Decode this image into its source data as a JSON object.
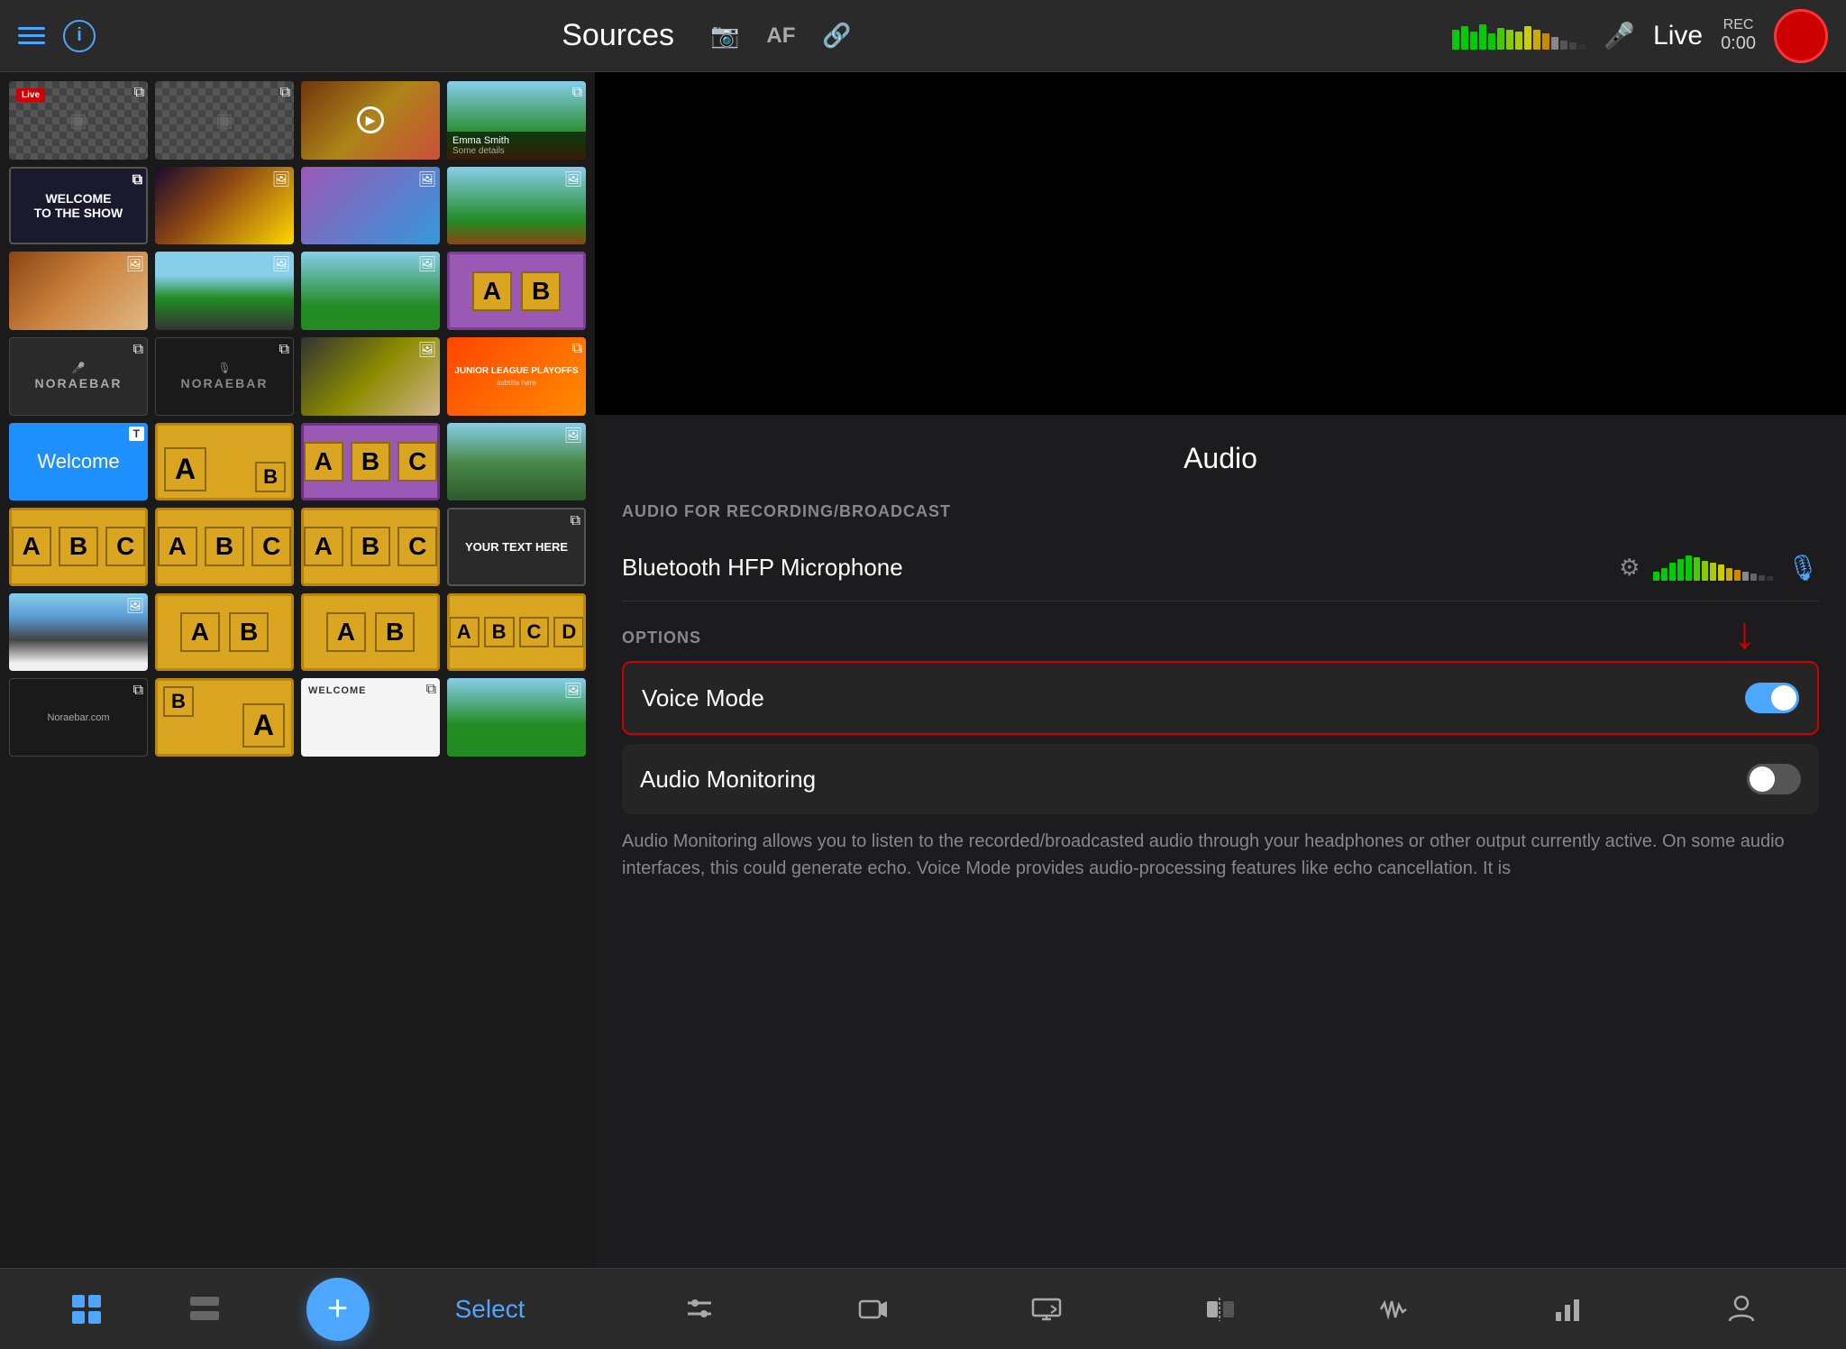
{
  "header": {
    "title": "Sources",
    "af_label": "AF",
    "live_label": "Live",
    "rec_label": "REC",
    "rec_time": "0:00"
  },
  "sources_grid": {
    "thumbnails": [
      {
        "id": 1,
        "type": "live_bar",
        "badge": "layers",
        "label": "Live"
      },
      {
        "id": 2,
        "type": "live_bar2",
        "badge": "layers",
        "label": ""
      },
      {
        "id": 3,
        "type": "crowd",
        "badge": "play",
        "label": ""
      },
      {
        "id": 4,
        "type": "person",
        "badge": "layers",
        "label": "Emma Smith"
      },
      {
        "id": 5,
        "type": "welcome",
        "badge": "layers",
        "text": "WELCOME TO THE SHOW",
        "label": ""
      },
      {
        "id": 6,
        "type": "concert",
        "badge": "image",
        "label": ""
      },
      {
        "id": 7,
        "type": "crowd2",
        "badge": "image",
        "label": ""
      },
      {
        "id": 8,
        "type": "city",
        "badge": "image",
        "label": ""
      },
      {
        "id": 9,
        "type": "building",
        "badge": "image",
        "label": ""
      },
      {
        "id": 10,
        "type": "city2",
        "badge": "image",
        "label": ""
      },
      {
        "id": 11,
        "type": "field",
        "badge": "image",
        "label": ""
      },
      {
        "id": 12,
        "type": "ab_purple",
        "badge": "",
        "label": "A B"
      },
      {
        "id": 13,
        "type": "norae",
        "badge": "layers",
        "label": "NORAEBAR"
      },
      {
        "id": 14,
        "type": "norae2",
        "badge": "layers",
        "label": "NORAEBAR"
      },
      {
        "id": 15,
        "type": "food",
        "badge": "image",
        "label": ""
      },
      {
        "id": 16,
        "type": "playoffs",
        "badge": "",
        "label": "JUNIOR LEAGUE PLAYOFFS"
      },
      {
        "id": 17,
        "type": "blue_welcome",
        "badge": "T",
        "label": "Welcome"
      },
      {
        "id": 18,
        "type": "ab2",
        "badge": "",
        "label": "A B"
      },
      {
        "id": 19,
        "type": "abc_purple",
        "badge": "",
        "label": "A B C"
      },
      {
        "id": 20,
        "type": "landscape",
        "badge": "image",
        "label": ""
      },
      {
        "id": 21,
        "type": "abc2",
        "badge": "",
        "label": "A B C"
      },
      {
        "id": 22,
        "type": "abc3",
        "badge": "",
        "label": "A B C"
      },
      {
        "id": 23,
        "type": "abc4",
        "badge": "",
        "label": "A B C"
      },
      {
        "id": 24,
        "type": "text_here",
        "badge": "layers",
        "text": "YOUR TEXT HERE",
        "label": ""
      },
      {
        "id": 25,
        "type": "water",
        "badge": "image",
        "label": ""
      },
      {
        "id": 26,
        "type": "ab3",
        "badge": "",
        "label": "A B"
      },
      {
        "id": 27,
        "type": "ab4",
        "badge": "",
        "label": "A B"
      },
      {
        "id": 28,
        "type": "abcd",
        "badge": "",
        "label": "A B C D"
      },
      {
        "id": 29,
        "type": "norae3",
        "badge": "layers",
        "label": "Noraebar.com"
      },
      {
        "id": 30,
        "type": "ba",
        "badge": "",
        "label": "B A"
      },
      {
        "id": 31,
        "type": "welcome2",
        "badge": "layers",
        "text": "WELCOME",
        "label": ""
      },
      {
        "id": 32,
        "type": "person2",
        "badge": "image",
        "label": ""
      }
    ]
  },
  "bottom_nav": {
    "grid_icon": "⊞",
    "layers_icon": "⧉",
    "add_label": "+",
    "select_label": "Select"
  },
  "audio": {
    "title": "Audio",
    "recording_section_label": "AUDIO FOR RECORDING/BROADCAST",
    "device_name": "Bluetooth HFP Microphone",
    "options_section_label": "OPTIONS",
    "voice_mode_label": "Voice Mode",
    "voice_mode_enabled": true,
    "audio_monitoring_label": "Audio Monitoring",
    "audio_monitoring_enabled": false,
    "description": "Audio Monitoring allows you to listen to the recorded/broadcasted audio through your headphones or other output currently active. On some audio interfaces, this could generate echo.\nVoice Mode provides audio-processing features like echo cancellation. It is"
  },
  "right_toolbar": {
    "items": [
      {
        "icon": "sliders",
        "label": "audio-settings"
      },
      {
        "icon": "video",
        "label": "video-settings"
      },
      {
        "icon": "output",
        "label": "output"
      },
      {
        "icon": "transition",
        "label": "transition"
      },
      {
        "icon": "waveform",
        "label": "waveform"
      },
      {
        "icon": "chart",
        "label": "analytics"
      },
      {
        "icon": "person",
        "label": "person"
      }
    ]
  },
  "colors": {
    "accent_blue": "#4da6ff",
    "recording_red": "#cc0000",
    "toggle_blue": "#4da6ff",
    "highlight_border": "#cc0000"
  }
}
